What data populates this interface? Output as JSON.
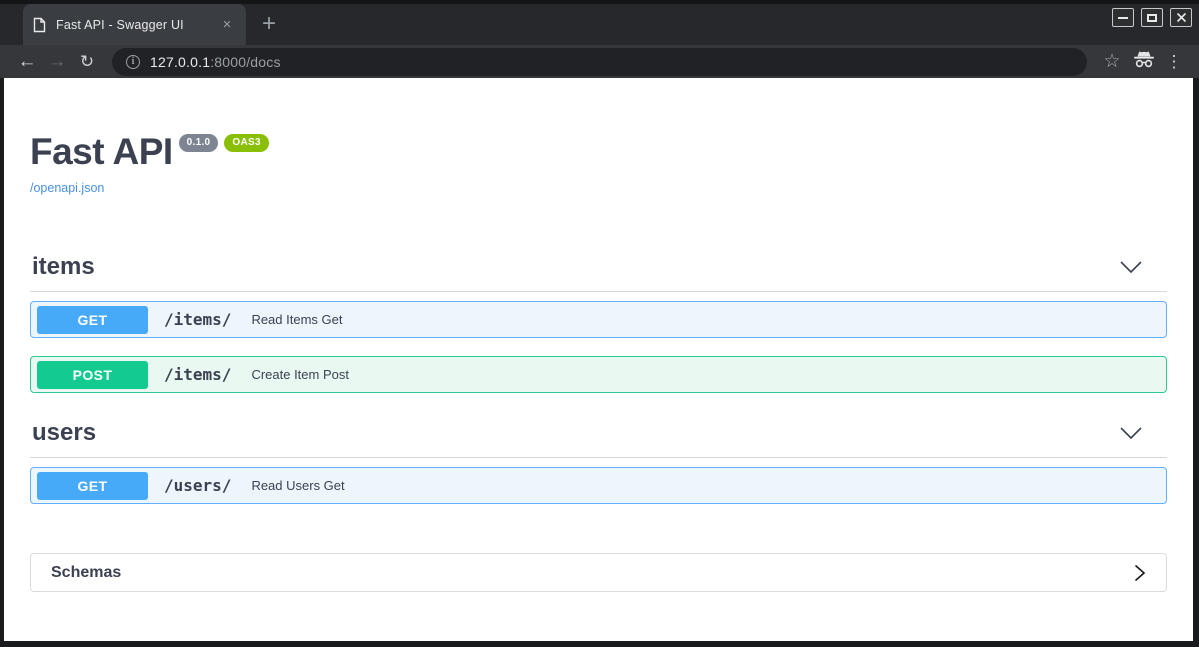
{
  "window": {
    "tab_title": "Fast API - Swagger UI"
  },
  "browser": {
    "url": {
      "host": "127.0.0.1",
      "rest": ":8000/docs"
    }
  },
  "icons": {
    "back": "←",
    "forward": "→",
    "reload": "↻",
    "star": "☆",
    "menu": "⋮",
    "tab_close": "×",
    "new_tab": "+",
    "info": "i"
  },
  "page": {
    "title": "Fast API",
    "version_badge": "0.1.0",
    "oas_badge": "OAS3",
    "spec_link": "/openapi.json",
    "sections": [
      {
        "name": "items",
        "operations": [
          {
            "method": "GET",
            "path": "/items/",
            "summary": "Read Items Get"
          },
          {
            "method": "POST",
            "path": "/items/",
            "summary": "Create Item Post"
          }
        ]
      },
      {
        "name": "users",
        "operations": [
          {
            "method": "GET",
            "path": "/users/",
            "summary": "Read Users Get"
          }
        ]
      }
    ],
    "schemas_label": "Schemas"
  },
  "colors": {
    "get_btn": "#47aaf8",
    "get_border": "#61affe",
    "get_bg": "#edf5fd",
    "post_btn": "#13ca90",
    "post_border": "#2cc991",
    "post_bg": "#eaf8f2",
    "version_badge_bg": "#7d8492",
    "oas_badge_bg": "#89bf04",
    "link": "#4990e2",
    "heading": "#3b4151"
  }
}
